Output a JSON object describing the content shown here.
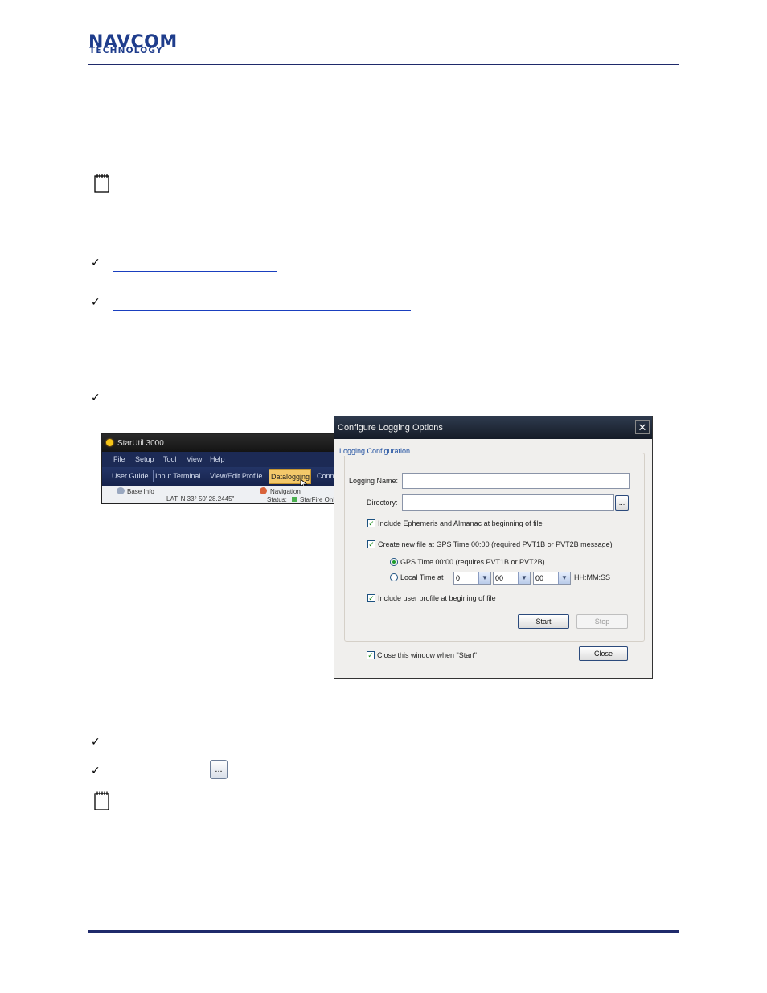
{
  "header": {
    "logo_main": "NAVCOM",
    "logo_sub": "TECHNOLOGY",
    "brand_color": "#1f3d8c"
  },
  "starutil": {
    "title": "StarUtil 3000",
    "menu": [
      "File",
      "Setup",
      "Tool",
      "View",
      "Help"
    ],
    "tabs": [
      "User Guide",
      "Input Terminal",
      "View/Edit Profile",
      "Datalogging",
      "Conn"
    ],
    "active_tab": "Datalogging",
    "panel_base_info": "Base Info",
    "lat_text": "LAT: N 33° 50' 28.2445\"",
    "panel_navigation": "Navigation",
    "status_label": "Status:",
    "status_value": "StarFire Onl"
  },
  "dialog": {
    "title": "Configure Logging Options",
    "close_glyph": "✕",
    "group_label": "Logging Configuration",
    "logging_name_label": "Logging Name:",
    "logging_name_value": "",
    "directory_label": "Directory:",
    "directory_value": "",
    "browse_label": "...",
    "opt_ephemeris": "Include Ephemeris and Almanac at beginning of file",
    "opt_new_file": "Create new file at GPS Time 00:00 (required PVT1B or PVT2B message)",
    "radio_gps": "GPS Time 00:00 (requires PVT1B or PVT2B)",
    "radio_local": "Local Time at",
    "time_h": "0",
    "time_m": "00",
    "time_s": "00",
    "time_format": "HH:MM:SS",
    "opt_user_profile": "Include user profile at begining of file",
    "start_label": "Start",
    "stop_label": "Stop",
    "close_on_start": "Close this window when \"Start\"",
    "close_label": "Close",
    "check_glyph": "✓"
  },
  "page": {
    "check_mark": "✓",
    "browse_icon_label": "..."
  }
}
